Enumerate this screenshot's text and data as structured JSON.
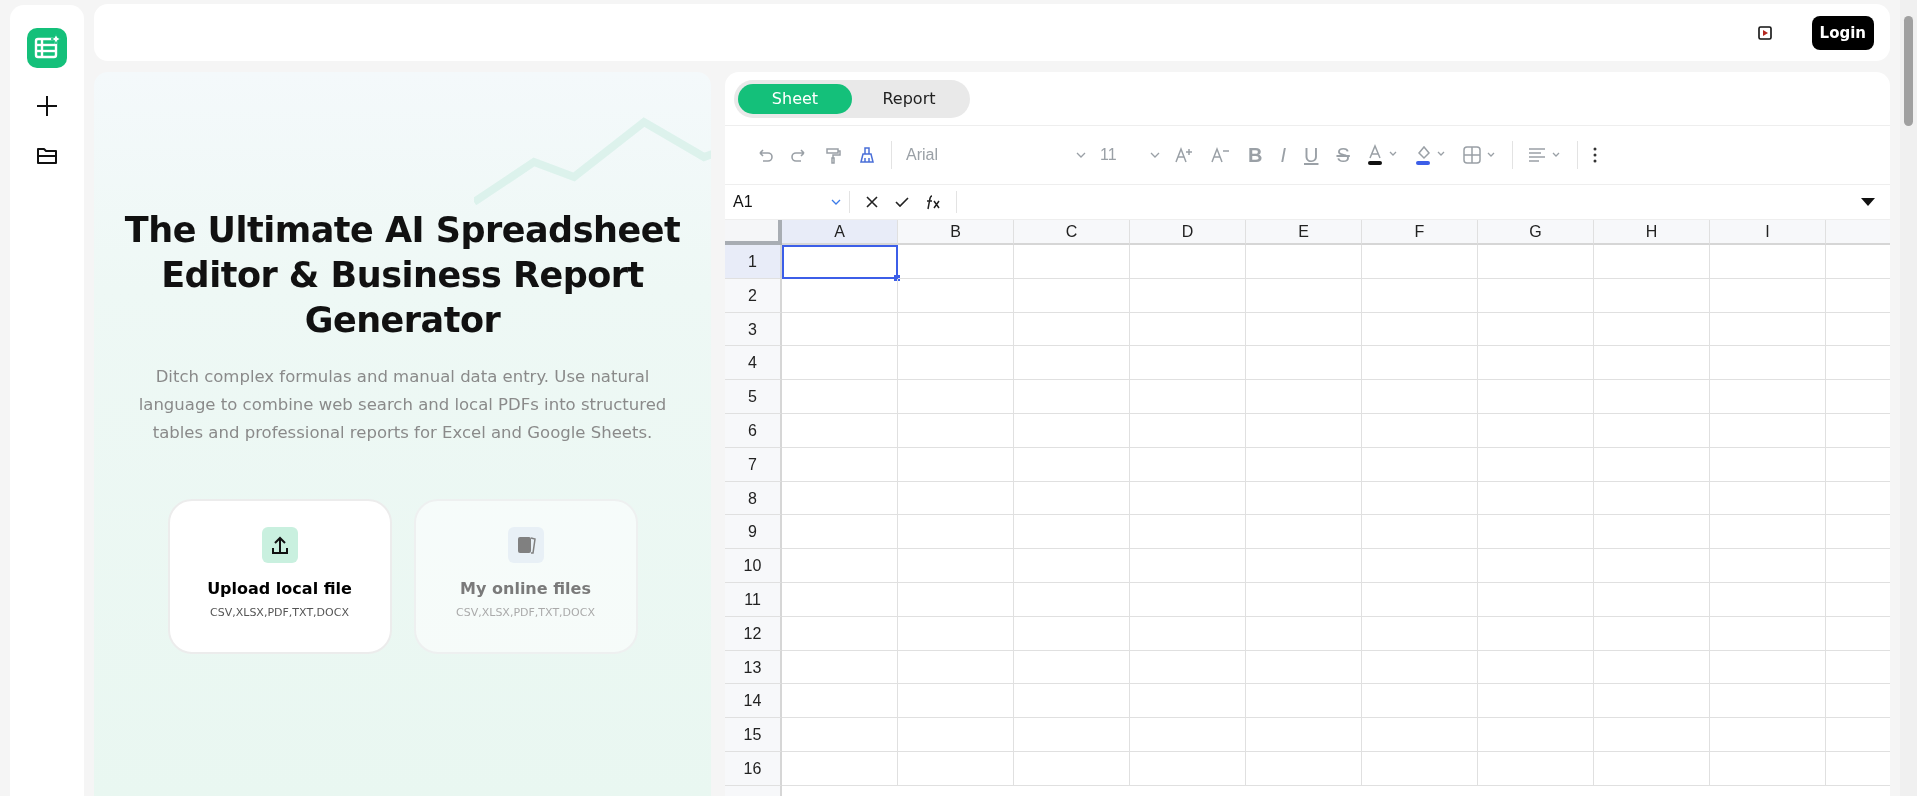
{
  "sidebar": {
    "items": [
      {
        "kind": "logo"
      },
      {
        "kind": "new"
      },
      {
        "kind": "folder"
      }
    ]
  },
  "top_bar": {
    "login_button": "Login"
  },
  "hero": {
    "title": "The Ultimate AI Spreadsheet Editor & Business Report Generator",
    "description": "Ditch complex formulas and manual data entry. Use natural language to combine web search and local PDFs into structured tables and professional reports for Excel and Google Sheets.",
    "cards": [
      {
        "kind": "upload",
        "title": "Upload local file",
        "formats": "CSV,XLSX,PDF,TXT,DOCX",
        "disabled": false
      },
      {
        "kind": "online",
        "title": "My online files",
        "formats": "CSV,XLSX,PDF,TXT,DOCX",
        "disabled": true
      }
    ]
  },
  "tabs": [
    {
      "label": "Sheet",
      "selected": true
    },
    {
      "label": "Report",
      "selected": false
    }
  ],
  "toolbar": {
    "font": "Arial",
    "font_size": "11",
    "bold": "B",
    "italic": "I",
    "underline": "U",
    "strikethrough": "S"
  },
  "formula_bar": {
    "cell_reference": "A1"
  },
  "sheet": {
    "columns": [
      {
        "label": "A",
        "selected": true
      },
      {
        "label": "B",
        "selected": false
      },
      {
        "label": "C",
        "selected": false
      },
      {
        "label": "D",
        "selected": false
      },
      {
        "label": "E",
        "selected": false
      },
      {
        "label": "F",
        "selected": false
      },
      {
        "label": "G",
        "selected": false
      },
      {
        "label": "H",
        "selected": false
      },
      {
        "label": "I",
        "selected": false
      }
    ],
    "rows": [
      {
        "label": "1",
        "selected": true
      },
      {
        "label": "2",
        "selected": false
      },
      {
        "label": "3",
        "selected": false
      },
      {
        "label": "4",
        "selected": false
      },
      {
        "label": "5",
        "selected": false
      },
      {
        "label": "6",
        "selected": false
      },
      {
        "label": "7",
        "selected": false
      },
      {
        "label": "8",
        "selected": false
      },
      {
        "label": "9",
        "selected": false
      },
      {
        "label": "10",
        "selected": false
      },
      {
        "label": "11",
        "selected": false
      },
      {
        "label": "12",
        "selected": false
      },
      {
        "label": "13",
        "selected": false
      },
      {
        "label": "14",
        "selected": false
      },
      {
        "label": "15",
        "selected": false
      },
      {
        "label": "16",
        "selected": false
      }
    ]
  }
}
